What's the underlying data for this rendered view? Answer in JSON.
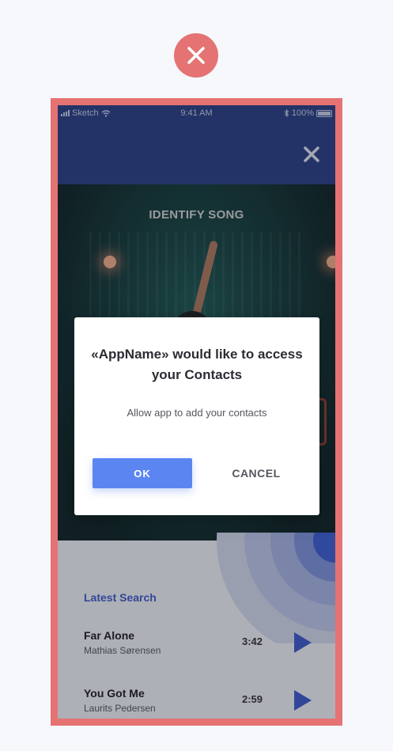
{
  "badge": {
    "icon": "close-icon",
    "color": "#e57373"
  },
  "statusbar": {
    "carrier": "Sketch",
    "time": "9:41 AM",
    "battery": "100%"
  },
  "header": {
    "close_icon": "close-icon",
    "color": "#2a3f86"
  },
  "hero": {
    "title": "IDENTIFY SONG"
  },
  "latest": {
    "heading": "Latest Search",
    "songs": [
      {
        "title": "Far Alone",
        "artist": "Mathias Sørensen",
        "duration": "3:42"
      },
      {
        "title": "You Got Me",
        "artist": "Laurits Pedersen",
        "duration": "2:59"
      }
    ]
  },
  "dialog": {
    "title": "«AppName» would like to access your Contacts",
    "message": "Allow app to add your contacts",
    "ok_label": "OK",
    "cancel_label": "CANCEL",
    "accent": "#5b86f2"
  }
}
